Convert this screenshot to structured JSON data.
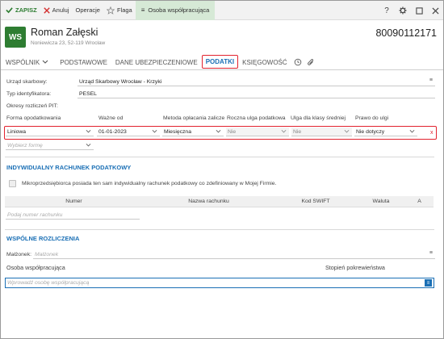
{
  "toolbar": {
    "save": "ZAPISZ",
    "cancel": "Anuluj",
    "operations": "Operacje",
    "flag": "Flaga",
    "contact": "Osoba współpracująca",
    "help_icon": "help-icon",
    "settings_icon": "gear-icon",
    "maximize_icon": "maximize-icon",
    "close_icon": "close-icon"
  },
  "header": {
    "initials": "WS",
    "name": "Roman Załęski",
    "address": "Noniewicza 23, 52-119 Wrocław",
    "nip": "80090112171"
  },
  "tabs": [
    {
      "label": "WSPÓLNIK"
    },
    {
      "label": "PODSTAWOWE"
    },
    {
      "label": "DANE UBEZPIECZENIOWE"
    },
    {
      "label": "PODATKI"
    },
    {
      "label": "KSIĘGOWOŚĆ"
    }
  ],
  "form": {
    "tax_office_label": "Urząd skarbowy:",
    "tax_office_value": "Urząd Skarbowy Wrocław - Krzyki",
    "id_type_label": "Typ identyfikatora:",
    "id_type_value": "PESEL",
    "periods_label": "Okresy rozliczeń PIT:"
  },
  "pit_table": {
    "headers": [
      "Forma opodatkowania",
      "Ważne od",
      "Metoda opłacania zaliczek",
      "Roczna ulga podatkowa",
      "Ulga dla klasy średniej",
      "Prawo do ulgi"
    ],
    "row": [
      "Liniowa",
      "01-01-2023",
      "Miesięczna",
      "Nie",
      "Nie",
      "Nie dotyczy"
    ],
    "new_placeholder": "Wybierz formę",
    "delete": "x"
  },
  "individual_account": {
    "title": "INDYWIDUALNY RACHUNEK PODATKOWY",
    "checkbox_label": "Mikroprzedsiębiorca posiada ten sam indywidualny rachunek podatkowy co zdefiniowany w Mojej Firmie.",
    "headers": [
      "Numer",
      "Nazwa rachunku",
      "Kod SWIFT",
      "Waluta",
      "A"
    ],
    "number_placeholder": "Podaj numer rachunku"
  },
  "joint": {
    "title": "WSPÓLNE ROZLICZENIA",
    "spouse_label": "Małżonek:",
    "spouse_placeholder": "Małżonek",
    "contact_label": "Osoba współpracująca",
    "relation_label": "Stopień pokrewieństwa",
    "contact_placeholder": "Wprowadź osobę współpracującą"
  },
  "colors": {
    "accent": "#1a6fb5",
    "save_green": "#2e7d32",
    "highlight_red": "#e2222e",
    "avatar_green": "#2e7d32"
  }
}
